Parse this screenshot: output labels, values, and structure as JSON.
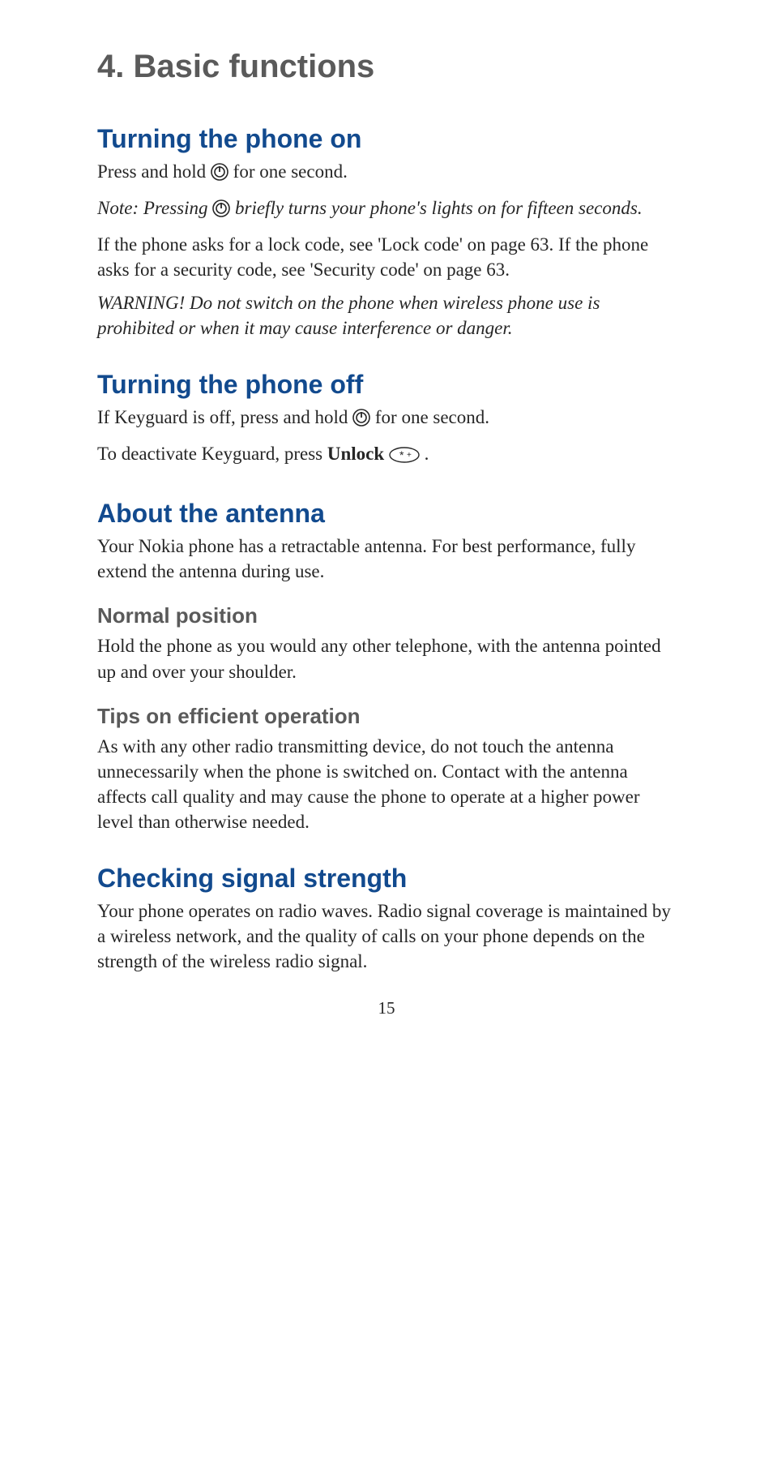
{
  "chapter": {
    "title": "4. Basic functions"
  },
  "sections": {
    "turning_on": {
      "heading": "Turning the phone on",
      "p1a": "Press and hold ",
      "p1b": " for one second.",
      "note_a": "Note: Pressing ",
      "note_b": " briefly turns your phone's lights on for fifteen seconds.",
      "p2": "If the phone asks for a lock code, see 'Lock code' on page 63. If the phone asks for a security code, see 'Security code' on page 63.",
      "warning": "WARNING! Do not switch on the phone when wireless phone use is prohibited or when it may cause interference or danger."
    },
    "turning_off": {
      "heading": "Turning the phone off",
      "p1a": "If Keyguard is off, press and hold ",
      "p1b": " for one second.",
      "p2a": "To deactivate Keyguard, press ",
      "p2_bold": "Unlock",
      "p2b": " ",
      "p2c": "."
    },
    "antenna": {
      "heading": "About the antenna",
      "p1": "Your Nokia phone has a retractable antenna. For best performance, fully extend the antenna during use.",
      "sub1": {
        "heading": "Normal position",
        "p1": "Hold the phone as you would any other telephone, with the antenna pointed up and over your shoulder."
      },
      "sub2": {
        "heading": "Tips on efficient operation",
        "p1": "As with any other radio transmitting device, do not touch the antenna unnecessarily when the phone is switched on. Contact with the antenna affects call quality and may cause the phone to operate at a higher power level than otherwise needed."
      }
    },
    "signal": {
      "heading": "Checking signal strength",
      "p1": "Your phone operates on radio waves. Radio signal coverage is maintained by a wireless network, and the quality of calls on your phone depends on the strength of the wireless radio signal."
    }
  },
  "page_number": "15"
}
